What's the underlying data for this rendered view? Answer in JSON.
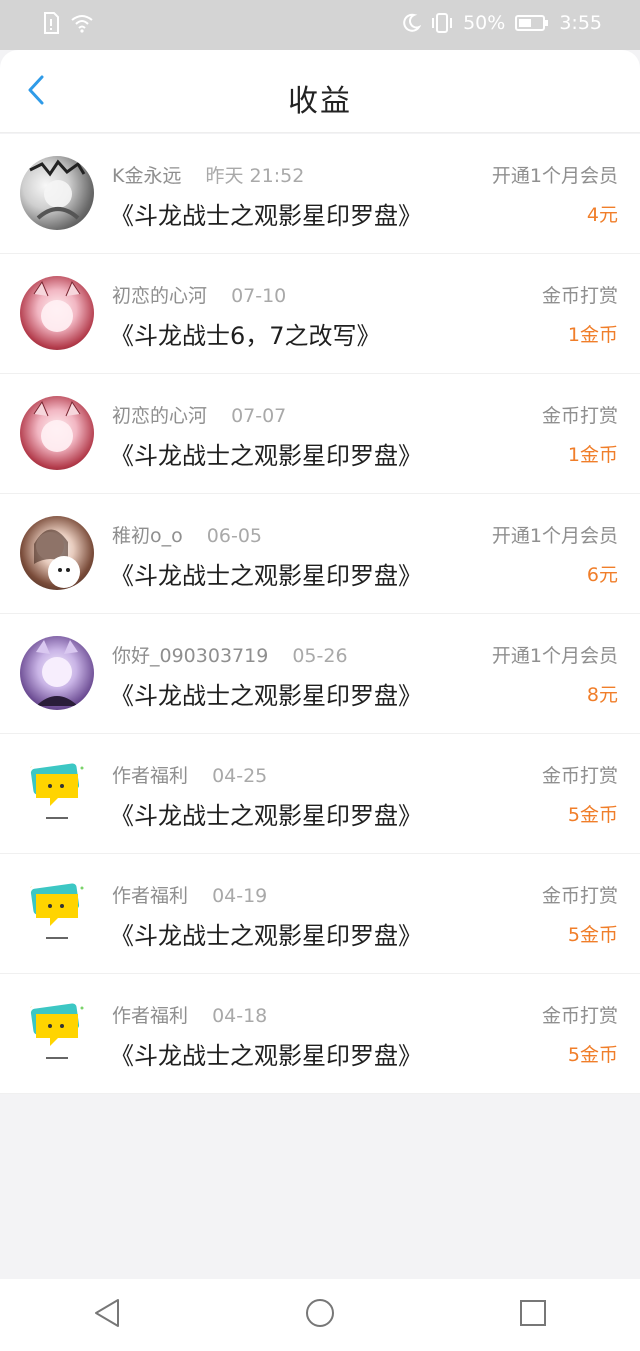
{
  "status_bar": {
    "battery_percent": "50%",
    "time": "3:55",
    "icons": [
      "sim-icon",
      "wifi-icon",
      "moon-icon",
      "vibrate-icon",
      "battery-icon"
    ]
  },
  "header": {
    "title": "收益",
    "back_icon": "chevron-left-icon",
    "accent_color": "#2f9be8"
  },
  "entries": [
    {
      "name": "K金永远",
      "date": "昨天 21:52",
      "book": "《斗龙战士之观影星印罗盘》",
      "type": "开通1个月会员",
      "amount": "4元"
    },
    {
      "name": "初恋的心河",
      "date": "07-10",
      "book": "《斗龙战士6，7之改写》",
      "type": "金币打赏",
      "amount": "1金币"
    },
    {
      "name": "初恋的心河",
      "date": "07-07",
      "book": "《斗龙战士之观影星印罗盘》",
      "type": "金币打赏",
      "amount": "1金币"
    },
    {
      "name": "稚初o_o",
      "date": "06-05",
      "book": "《斗龙战士之观影星印罗盘》",
      "type": "开通1个月会员",
      "amount": "6元"
    },
    {
      "name": "你好_090303719",
      "date": "05-26",
      "book": "《斗龙战士之观影星印罗盘》",
      "type": "开通1个月会员",
      "amount": "8元"
    },
    {
      "name": "作者福利",
      "date": "04-25",
      "book": "《斗龙战士之观影星印罗盘》",
      "type": "金币打赏",
      "amount": "5金币"
    },
    {
      "name": "作者福利",
      "date": "04-19",
      "book": "《斗龙战士之观影星印罗盘》",
      "type": "金币打赏",
      "amount": "5金币"
    },
    {
      "name": "作者福利",
      "date": "04-18",
      "book": "《斗龙战士之观影星印罗盘》",
      "type": "金币打赏",
      "amount": "5金币"
    }
  ],
  "colors": {
    "amount": "#f07e2a",
    "secondary_text": "#8f8f8f",
    "primary_text": "#1f1f1f"
  },
  "bottom_nav": {
    "icons": [
      "back-triangle-icon",
      "home-circle-icon",
      "recents-square-icon"
    ]
  }
}
